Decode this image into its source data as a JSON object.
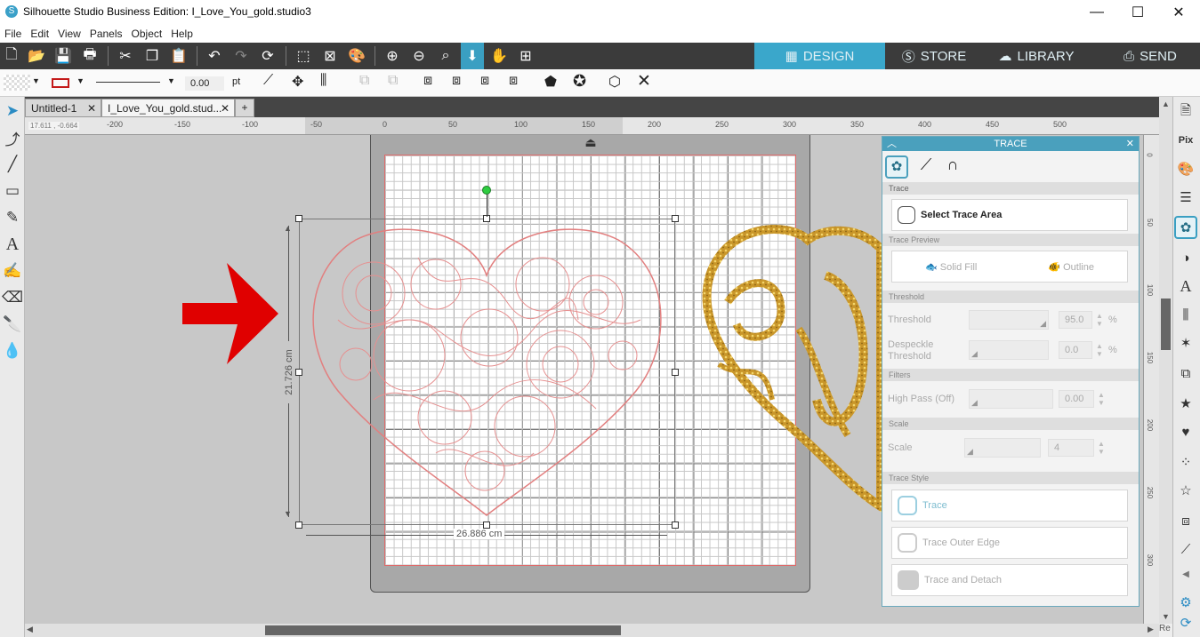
{
  "window": {
    "title": "Silhouette Studio Business Edition: I_Love_You_gold.studio3",
    "min": "—",
    "max": "☐",
    "close": "✕"
  },
  "menu": [
    "File",
    "Edit",
    "View",
    "Panels",
    "Object",
    "Help"
  ],
  "nav": {
    "design": "DESIGN",
    "store": "STORE",
    "library": "LIBRARY",
    "send": "SEND"
  },
  "toolbar2": {
    "line_width": "0.00",
    "unit": "pt"
  },
  "tabs": [
    {
      "label": "Untitled-1",
      "close": "✕"
    },
    {
      "label": "I_Love_You_gold.stud...",
      "close": "✕"
    }
  ],
  "add_tab": "+",
  "coords": "17.611 , -0.664",
  "ruler_h": [
    "-200",
    "-150",
    "-100",
    "-50",
    "0",
    "50",
    "100",
    "150",
    "200",
    "250",
    "300",
    "350",
    "400",
    "450",
    "500"
  ],
  "ruler_v": [
    "0",
    "50",
    "100",
    "150",
    "200",
    "250",
    "300"
  ],
  "dimensions": {
    "height": "21.726 cm",
    "width": "26.886 cm"
  },
  "trace": {
    "header": "TRACE",
    "section_trace": "Trace",
    "select_area": "Select Trace Area",
    "section_preview": "Trace Preview",
    "solid_fill": "Solid Fill",
    "outline": "Outline",
    "section_threshold": "Threshold",
    "threshold_label": "Threshold",
    "threshold_value": "95.0",
    "threshold_unit": "%",
    "despeckle_label_1": "Despeckle",
    "despeckle_label_2": "Threshold",
    "despeckle_value": "0.0",
    "despeckle_unit": "%",
    "section_filters": "Filters",
    "highpass_label": "High Pass (Off)",
    "highpass_value": "0.00",
    "section_scale": "Scale",
    "scale_label": "Scale",
    "scale_value": "4",
    "section_style": "Trace Style",
    "trace_btn": "Trace",
    "outer_edge_btn": "Trace Outer Edge",
    "detach_btn": "Trace and Detach"
  },
  "corner": "Re"
}
